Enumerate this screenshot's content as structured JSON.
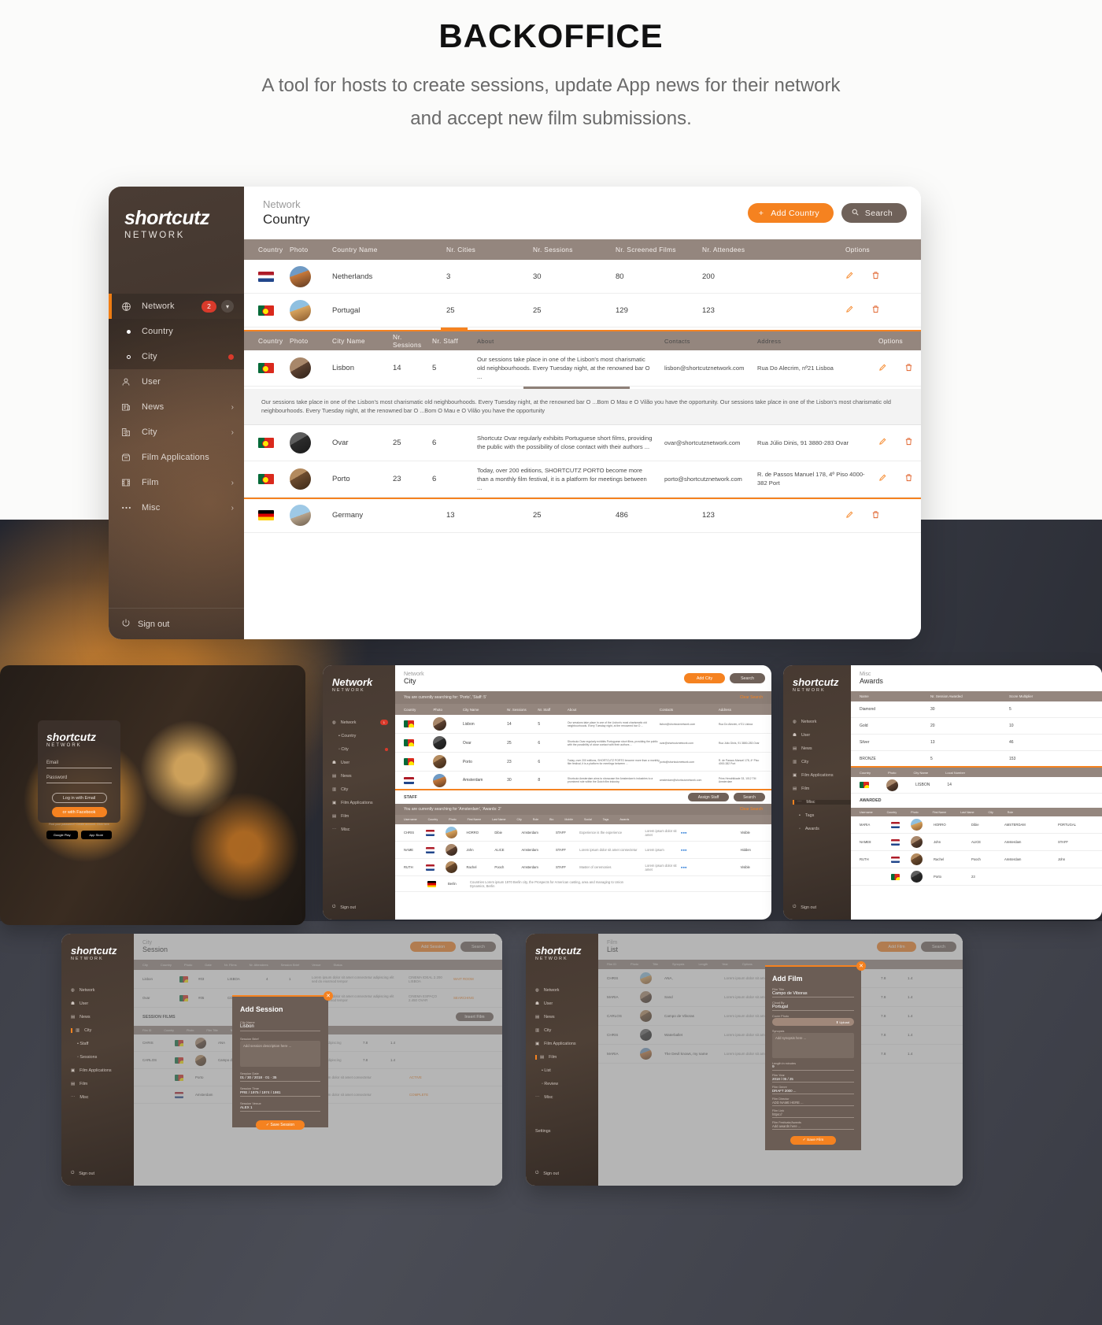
{
  "header": {
    "title": "BACKOFFICE",
    "subtitle_line1": "A tool for hosts to create sessions, update App news for their network",
    "subtitle_line2": "and accept new film submissions."
  },
  "app": {
    "logo": {
      "main": "shortcutz",
      "sub": "NETWORK"
    },
    "breadcrumb": {
      "parent": "Network",
      "current": "Country"
    },
    "actions": {
      "add_label": "Add Country",
      "add_icon": "plus-icon",
      "add_color": "#f58220",
      "search_label": "Search",
      "search_icon": "search-icon",
      "search_color": "#6f6159"
    },
    "sidebar": {
      "items": [
        {
          "label": "Network",
          "icon": "globe-icon",
          "badge": "2",
          "chevron": "chevron-down-icon",
          "active": true
        },
        {
          "label": "Country",
          "icon": "dot-filled-icon",
          "sub": true,
          "selected": true
        },
        {
          "label": "City",
          "icon": "dot-hollow-icon",
          "sub": true,
          "reddot": true
        },
        {
          "label": "User",
          "icon": "user-icon"
        },
        {
          "label": "News",
          "icon": "news-icon",
          "arrow": "›"
        },
        {
          "label": "City",
          "icon": "buildings-icon",
          "arrow": "›"
        },
        {
          "label": "Film Applications",
          "icon": "inbox-icon"
        },
        {
          "label": "Film",
          "icon": "filmstrip-icon",
          "arrow": "›"
        },
        {
          "label": "Misc",
          "icon": "ellipsis-icon",
          "arrow": "›"
        }
      ],
      "signout": {
        "label": "Sign out",
        "icon": "power-icon"
      }
    },
    "country_table": {
      "columns": [
        "Country",
        "Photo",
        "Country Name",
        "Nr. Cities",
        "Nr. Sessions",
        "Nr. Screened Films",
        "Nr. Attendees",
        "Options"
      ],
      "rows": [
        {
          "flag": "nl",
          "name": "Netherlands",
          "cities": "3",
          "sessions": "30",
          "films": "80",
          "attendees": "200"
        },
        {
          "flag": "pt",
          "name": "Portugal",
          "cities": "25",
          "sessions": "25",
          "films": "129",
          "attendees": "123"
        }
      ]
    },
    "city_table": {
      "columns": [
        "Country",
        "Photo",
        "City Name",
        "Nr. Sessions",
        "Nr. Staff",
        "About",
        "Contacts",
        "Address",
        "Options"
      ],
      "rows": [
        {
          "flag": "pt",
          "name": "Lisbon",
          "sessions": "14",
          "staff": "5",
          "about": "Our sessions take place in one of the Lisbon's most charismatic old neighbourhoods. Every Tuesday night, at the renowned bar O ...",
          "contact": "lisbon@shortcutznetwork.com",
          "address": "Rua Do Alecrim, nº21 Lisboa"
        },
        {
          "flag": "pt",
          "name": "Ovar",
          "sessions": "25",
          "staff": "6",
          "about": "Shortcutz Ovar regularly exhibits Portuguese short films, providing the public with the possibility of close contact with their authors ...",
          "contact": "ovar@shortcutznetwork.com",
          "address": "Rua Júlio Dinis, 91 3880-283 Ovar"
        },
        {
          "flag": "pt",
          "name": "Porto",
          "sessions": "23",
          "staff": "6",
          "about": "Today, over 200 editions, SHORTCUTZ PORTO become more than a monthly film festival, it is a platform for meetings between ...",
          "contact": "porto@shortcutznetwork.com",
          "address": "R. de Passos Manuel 178, 4º Piso 4000-382 Port"
        }
      ],
      "expanded_text": "Our sessions take place in one of the Lisbon's most charismatic old neighbourhoods. Every Tuesday night, at the renowned bar O ...Bom O Mau e O Vilão you have the opportunity. Our sessions take place in one of the Lisbon's most charismatic old neighbourhoods. Every Tuesday night, at the renowned bar O ...Bom O Mau e O Vilão you have the opportunity"
    },
    "germany_row": {
      "flag": "de",
      "name": "Germany",
      "cities": "13",
      "sessions": "25",
      "films": "486",
      "attendees": "123"
    },
    "option_icons": {
      "edit": "pencil-icon",
      "delete": "trash-icon",
      "edit_color": "#f58220",
      "delete_color": "#f58220"
    }
  },
  "thumbs": {
    "login": {
      "logo_main": "shortcutz",
      "logo_sub": "NETWORK",
      "email_placeholder": "Email",
      "password_placeholder": "Password",
      "btn_email": "Log in with Email",
      "btn_facebook": "or with Facebook",
      "footnote": "Find your password? Create account. Click here",
      "store_google": "Google Play",
      "store_apple": "App Store"
    },
    "city": {
      "breadcrumb_parent": "Network",
      "breadcrumb_current": "City",
      "add_label": "Add City",
      "search_label": "Search",
      "search_banner": "You are currently searching for: 'Porto', 'Staff: 5'",
      "clear_label": "Clear Search",
      "columns": [
        "Country",
        "Photo",
        "City Name",
        "Nr. Sessions",
        "Nr. Staff",
        "About",
        "Contacts",
        "Address"
      ],
      "rows": [
        {
          "flag": "pt",
          "name": "Lisbon",
          "sessions": "14",
          "staff": "5"
        },
        {
          "flag": "pt",
          "name": "Ovar",
          "sessions": "25",
          "staff": "6"
        },
        {
          "flag": "pt",
          "name": "Porto",
          "sessions": "23",
          "staff": "6"
        },
        {
          "flag": "nl",
          "name": "Amsterdam",
          "sessions": "30",
          "staff": "8"
        }
      ],
      "staff_title": "STAFF",
      "assign_label": "Assign Staff",
      "staff_search_label": "Search",
      "staff_banner": "You are currently searching for 'Amsterdam', 'Awards: 2'",
      "staff_columns": [
        "Username",
        "Country",
        "Photo",
        "First Name",
        "Last Name",
        "City",
        "Role",
        "Bio",
        "Mobile",
        "Social",
        "Tags",
        "Awards",
        "Points",
        "Status"
      ],
      "staff_rows": [
        {
          "user": "CHRIS",
          "flag": "nl",
          "first": "HORRO",
          "last": "Dibie",
          "city": "Amsterdam",
          "role": "STAFF",
          "status": "Visible"
        },
        {
          "user": "NAME",
          "flag": "nl",
          "first": "John",
          "last": "ALICE",
          "city": "Amsterdam",
          "role": "STAFF",
          "status": "Hidden"
        },
        {
          "user": "RUTH",
          "flag": "nl",
          "first": "Rachel",
          "last": "Pooch",
          "city": "Amsterdam",
          "role": "STAFF",
          "status": "Visible"
        },
        {
          "user": "",
          "flag": "de",
          "first": "Berlin",
          "last": "",
          "city": "",
          "role": "",
          "status": ""
        }
      ]
    },
    "misc": {
      "breadcrumb_parent": "Misc",
      "breadcrumb_current": "Awards",
      "columns": [
        "Name",
        "Nr. Session Awarded",
        "Score Multiplier"
      ],
      "rows": [
        {
          "name": "Diamond",
          "sessions": "30",
          "score": "5"
        },
        {
          "name": "Gold",
          "sessions": "20",
          "score": "10"
        },
        {
          "name": "Silver",
          "sessions": "13",
          "score": "46"
        },
        {
          "name": "BRONZE",
          "sessions": "5",
          "score": "153"
        }
      ],
      "section2_title": "AWARDED",
      "nav": [
        "Network",
        "User",
        "News",
        "City",
        "Film Applications",
        "Film",
        "Misc",
        "Tags",
        "Awards"
      ],
      "sub_columns": [
        "Country",
        "Photo",
        "City Name",
        "Local Number"
      ],
      "sub_row": {
        "city": "LISBON",
        "num": "14"
      },
      "awarded_rows": [
        {
          "user": "MARIA",
          "first": "HORRO",
          "last": "Dibie",
          "city": "AMSTERDAM",
          "role": "PORTUGAL"
        },
        {
          "user": "NAME8",
          "first": "John",
          "last": "ALICE",
          "city": "Amsterdam",
          "role": "STAFF"
        },
        {
          "user": "RUTH",
          "first": "Rachel",
          "last": "Pooch",
          "city": "Amsterdam",
          "role": "John"
        },
        {
          "user": "",
          "first": "Porto",
          "last": "23",
          "city": "",
          "role": ""
        }
      ]
    },
    "session": {
      "breadcrumb_parent": "City",
      "breadcrumb_current": "Session",
      "add_label": "Add Session",
      "search_label": "Search",
      "section_title": "SESSION FILMS",
      "insert_label": "Insert Film",
      "modal": {
        "title": "Add Session",
        "city_label": "City Name",
        "city_value": "Lisbon",
        "brief_label": "Session Brief",
        "brief_placeholder": "Add session description here ...",
        "date_label": "Session Date",
        "date_value": "01 / 30 / 2018 · 01 · 35",
        "time_label": "Session Time",
        "time_value": "PRE / 1975 / 1974 / 1981",
        "venue_label": "Session Venue",
        "venue_value": "ALEX 1",
        "save_label": "Save Session"
      },
      "columns": [
        "City",
        "Country",
        "Photo",
        "Date",
        "Nr. Films",
        "Nr. Attendees",
        "Session Brief",
        "Venue",
        "Status"
      ],
      "rows": [
        {
          "city": "Lisbon",
          "code": "#03",
          "date": "10/2018",
          "films": "4"
        },
        {
          "city": "Ovar",
          "code": "#05",
          "date": "09/4/2018",
          "films": "7"
        },
        {
          "city": "Lisbon",
          "code": "",
          "date": "",
          "films": ""
        },
        {
          "city": "Porto",
          "code": "#03",
          "date": "POSITION",
          "films": ""
        },
        {
          "city": "Amsterdam",
          "code": "#05",
          "date": "01/4/2018",
          "films": ""
        }
      ],
      "statuses": [
        "WAIT ROOM",
        "SEARCHING",
        "",
        "ACTIVE",
        "COMPLETE"
      ]
    },
    "film": {
      "breadcrumb_parent": "Film",
      "breadcrumb_current": "List",
      "add_label": "Add Film",
      "search_label": "Search",
      "modal": {
        "title": "Add Film",
        "film_title_label": "Film Title",
        "film_title_value": "Campo de Viboras",
        "country_label": "Cloud By",
        "country_value": "Portugal",
        "cover_label": "Cover Photo",
        "cover_btn": "Upload",
        "synopsis_label": "Synopsis",
        "synopsis_placeholder": "Add synopsis here ...",
        "length_label": "Length in minutes",
        "length_value": "9",
        "year_label": "Film Year",
        "year_value": "2018 / 05 / 25",
        "genre_label": "Film Genre",
        "genre_value": "DRAFT 2000 ...",
        "director_label": "Film Director",
        "director_placeholder": "ADD NAME HERE ...",
        "link_label": "Film Link",
        "link_placeholder": "https://",
        "awards_label": "Film Festivals/Awards",
        "awards_placeholder": "Add awards here ...",
        "save_label": "Save Film"
      },
      "rows": [
        {
          "id": "CHRIS",
          "title": "ANA,"
        },
        {
          "id": "MARIA",
          "title": "Sand"
        },
        {
          "id": "CARLOS",
          "title": "Campo de Viboras"
        },
        {
          "id": "CHRIS",
          "title": "Waterballet"
        },
        {
          "id": "MARIA",
          "title": "The Devil knows, my name"
        }
      ]
    }
  }
}
